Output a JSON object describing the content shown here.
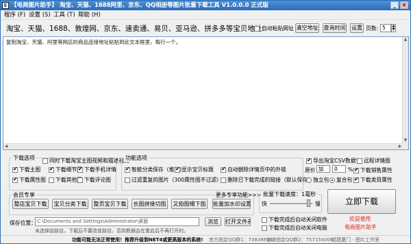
{
  "window": {
    "title": "【电商图片助手】 淘宝、天猫、1688阿里、京东、QQ相册等图片批量下载工具 V1.0.0.0 正式版",
    "icon_label": "E",
    "btn_min": "_",
    "btn_close": "✕"
  },
  "menu": [
    "程序 (F)",
    "设置 (S)",
    "工具 (T)",
    "帮助 (H)"
  ],
  "url_row": {
    "label": "淘宝、天猫、1688、敦煌网、京东、速卖通、易贝、亚马逊、拼多多等宝贝地址:",
    "auto_paste": "自动粘贴网址",
    "clear_btn": "清空地址",
    "timing_btn": "查询时间",
    "settings_btn": "设置",
    "pages_label": "页数:",
    "pages_value": "5"
  },
  "textarea": {
    "hint": "复制淘宝、天猫、阿里等网店的商品连接地址粘贴到此文本框里，每行一个。"
  },
  "download_options": {
    "title": "下载选项",
    "items": [
      {
        "label": "同时下载淘宝主图视频和描述视频",
        "checked": false
      },
      {
        "label": "下载主图",
        "checked": true
      },
      {
        "label": "下载细节图",
        "checked": true
      },
      {
        "label": "下载手机详情",
        "checked": true
      },
      {
        "label": "下载属性图",
        "checked": true
      },
      {
        "label": "下载其他图",
        "checked": false
      },
      {
        "label": "下载评论图",
        "checked": false
      }
    ]
  },
  "features": {
    "title": "功能选项",
    "items": [
      {
        "label": "智能分类保存（推荐）",
        "checked": true
      },
      {
        "label": "显示宝贝标题",
        "checked": true
      },
      {
        "label": "自动删除详情页中的外链",
        "checked": true
      },
      {
        "label": "过滤重复的图片（300属性图不过滤）",
        "checked": false
      },
      {
        "label": "删除已下载完成的链接（默认保存）",
        "checked": false
      }
    ]
  },
  "right_options": {
    "csv": "导出淘宝CSV数据包",
    "csv_checked": true,
    "filter": "远程详情图",
    "filter_checked": false,
    "price_label": "原价",
    "price_value": "加",
    "price_num": "0",
    "percent": "%",
    "sales": "下载销售属性",
    "sales_checked": true,
    "single": "独立包",
    "combined": "复合包",
    "combined_selected": true,
    "category": "下载类目属性",
    "category_checked": true
  },
  "members": {
    "title": "会员专享",
    "buttons": [
      "整店宝贝下载",
      "宝贝分类下载",
      "整页宝贝下载",
      "长图拼接切图",
      "又拍图细下图"
    ]
  },
  "more": {
    "label": "更多专享功能>>>",
    "watermark_btn": "批量加水印设置"
  },
  "speed": {
    "title": "批量下载速度：1毫秒",
    "fast": "快",
    "slow": "慢",
    "fraction": 0.95,
    "opt_close": "下载完成后自动关闭软件",
    "opt_shutdown": "下载完成后自动关闭电脑"
  },
  "download_btn": "立即下载",
  "links": {
    "welcome": "欢迎使用",
    "assistant": "电商图片助手"
  },
  "save": {
    "label": "保存位置：",
    "path": "C:\\Documents and Settings\\Administrator\\桌面",
    "browse": "浏览",
    "open": "打开文件夹",
    "note": "未选择前路径，下载后不要改变路径，否则数据会在重启后不再打开的。"
  },
  "status": {
    "a": "功能可能无法正常使用！推荐升级到NET4或更高版本的系统!",
    "b": "官方指定QQ群1：738388140",
    "c": "官方指定QQ群2：757154006",
    "d": "福建厦门 - 图片工作室"
  }
}
